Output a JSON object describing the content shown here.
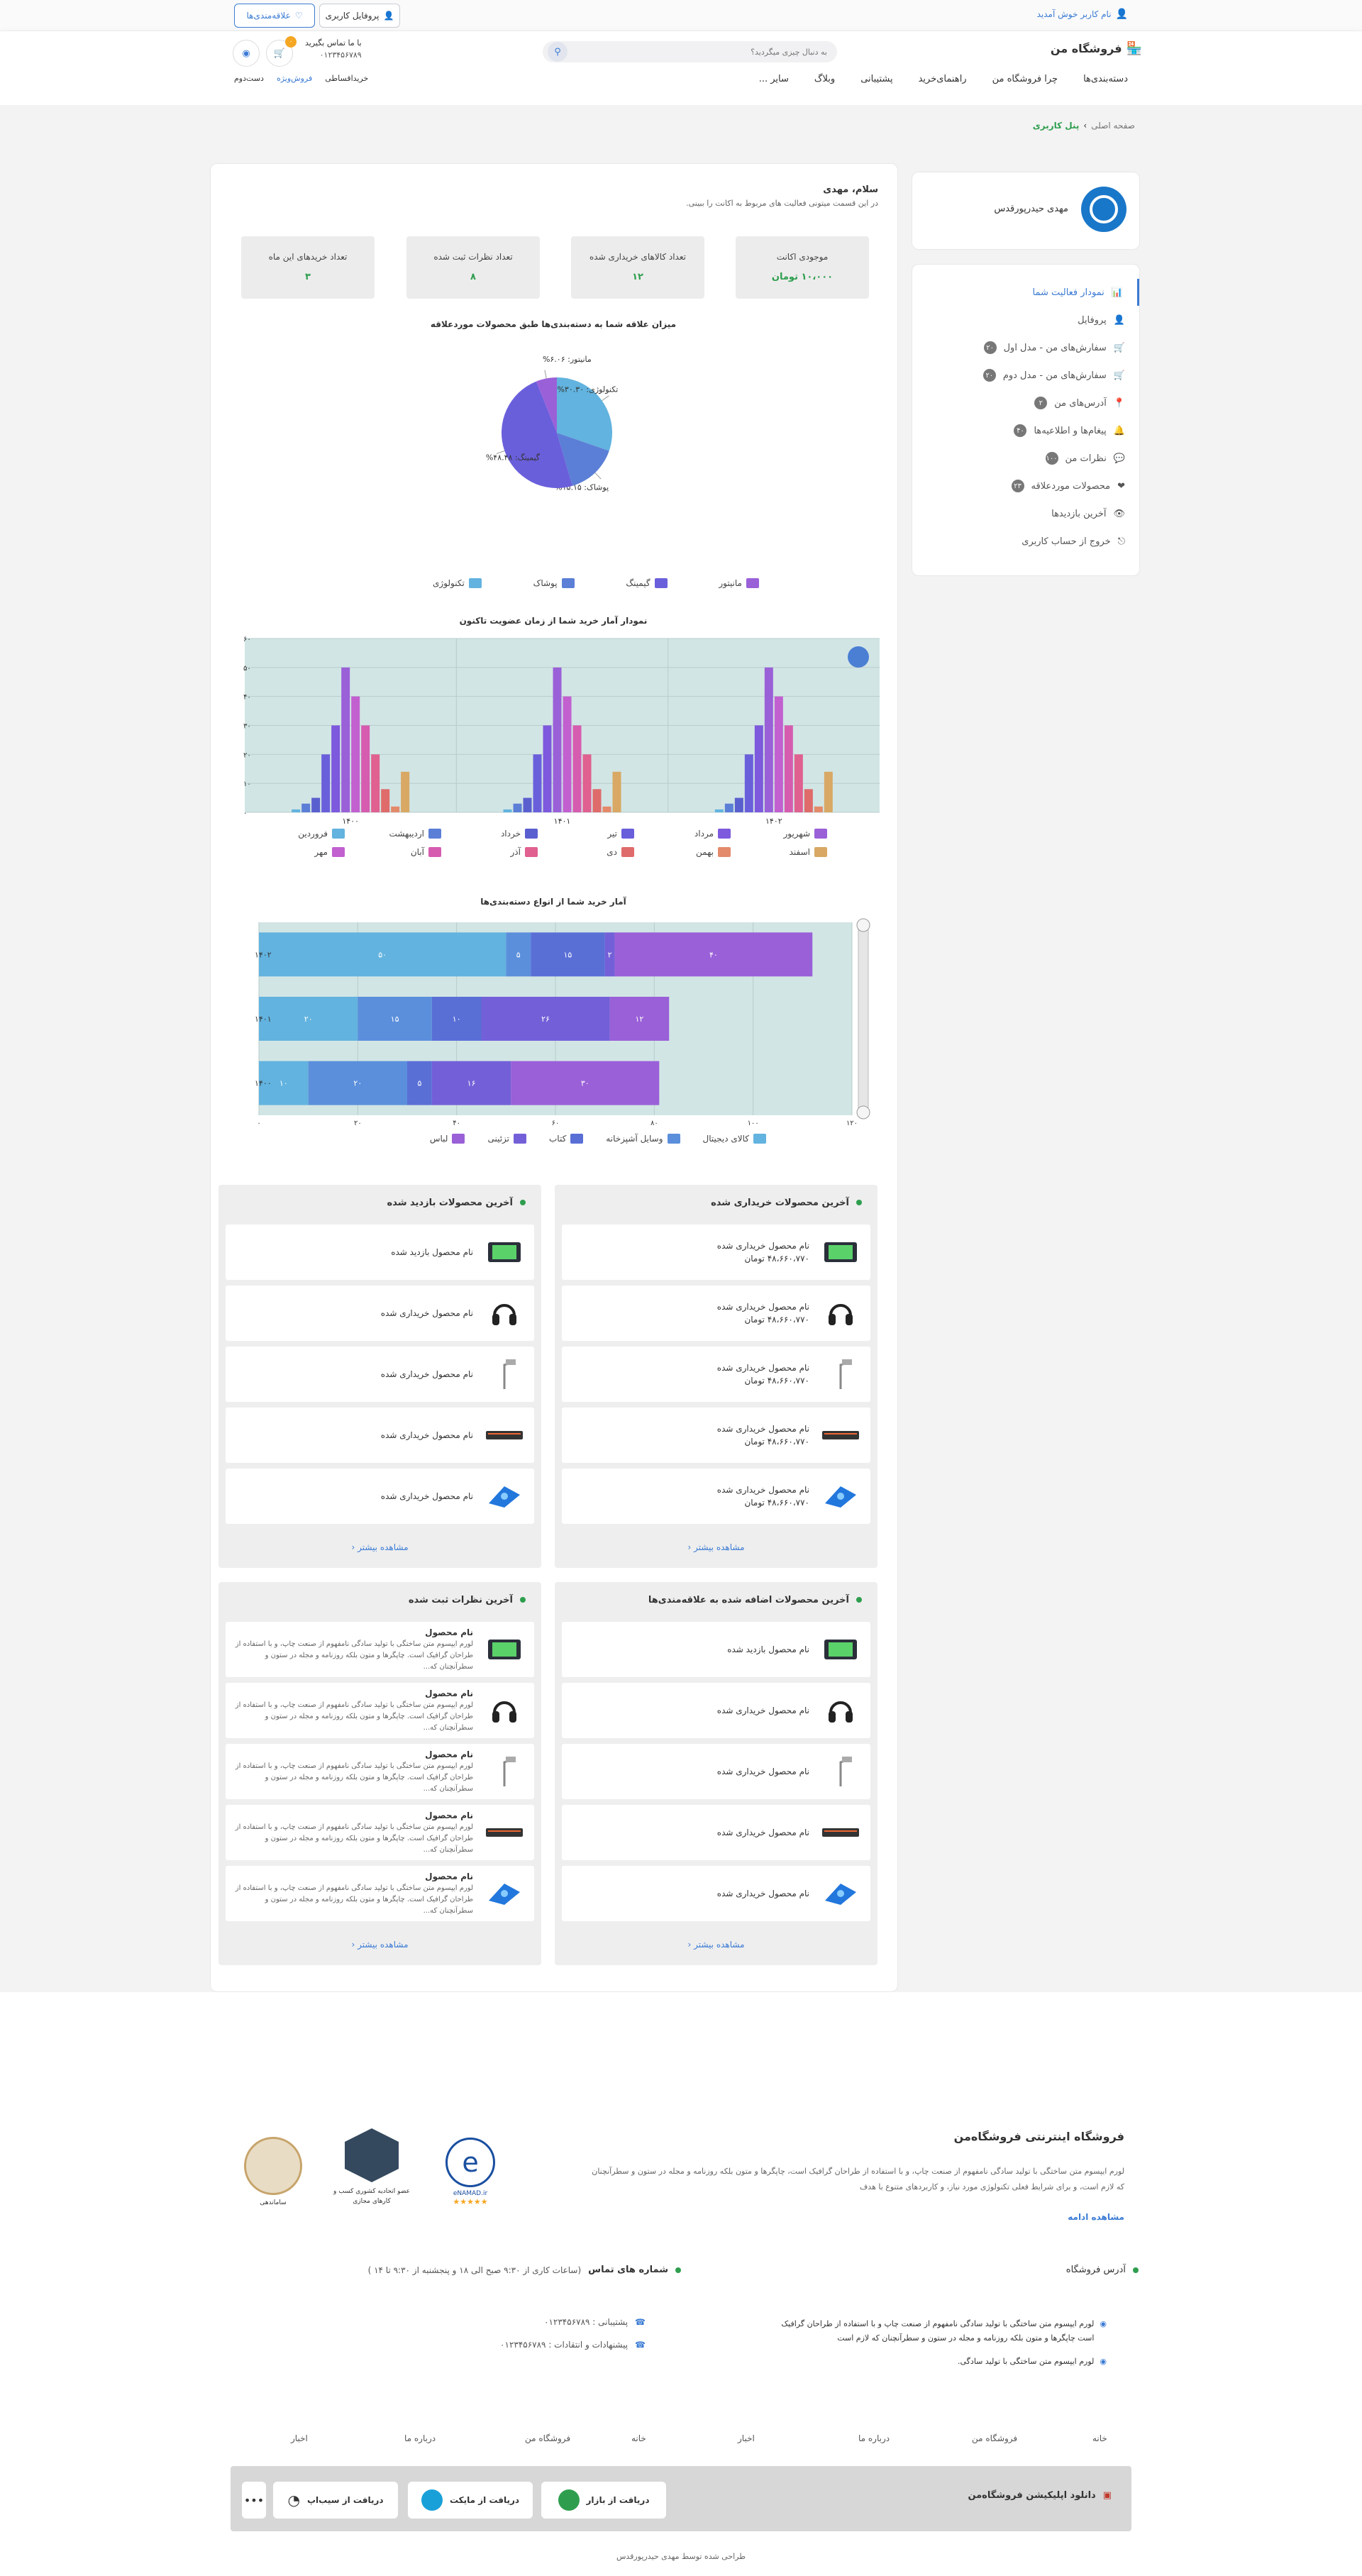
{
  "topbar": {
    "welcome": "نام کاربر خوش آمدید",
    "profile_btn": "پروفایل کاربری",
    "wishlist_btn": "علاقه‌مندی‌ها"
  },
  "header": {
    "logo": "فروشگاه من",
    "search_placeholder": "به دنبال چیزی میگردید؟",
    "contact_label": "با ما تماس بگیرید",
    "contact_phone": "۰۱۲۳۴۵۶۷۸۹",
    "cart_count": "۰",
    "nav": [
      "دسته‌بندی‌ها",
      "چرا فروشگاه من",
      "راهنمای‌خرید",
      "پشتیبانی",
      "وبلاگ",
      "سایر ..."
    ],
    "sub_nav": [
      "خرید‌اقساطی",
      "فروش‌ویژه",
      "دست‌دوم"
    ]
  },
  "breadcrumb": {
    "home": "صفحه اصلی",
    "current": "پنل کاربری"
  },
  "sidebar": {
    "user_name": "مهدی حیدرپورقدس",
    "items": [
      {
        "label": "نمودار فعالیت شما",
        "badge": ""
      },
      {
        "label": "پروفایل",
        "badge": ""
      },
      {
        "label": "سفارش‌های من - مدل اول",
        "badge": "۲۰"
      },
      {
        "label": "سفارش‌های من - مدل دوم",
        "badge": "۲۰"
      },
      {
        "label": "آدرس‌های من",
        "badge": "۲"
      },
      {
        "label": "پیغام‌ها و اطلاعیه‌ها",
        "badge": "۴۰"
      },
      {
        "label": "نظرات من",
        "badge": "۱۰۰"
      },
      {
        "label": "محصولات مورد‌علاقه",
        "badge": "۲۳"
      },
      {
        "label": "آخرین بازدیدها",
        "badge": ""
      },
      {
        "label": "خروج از حساب کاربری",
        "badge": ""
      }
    ]
  },
  "main": {
    "greeting": "سلام، مهدی",
    "intro": "در این قسمت میتونی فعالیت های مربوط به اکانت را ببینی.",
    "stats": [
      {
        "title": "موجودی اکانت",
        "value": "۱۰،۰۰۰ تومان"
      },
      {
        "title": "تعداد کالاهای خریداری شده",
        "value": "۱۲"
      },
      {
        "title": "تعداد نظرات ثبت شده",
        "value": "۸"
      },
      {
        "title": "تعداد خریدهای این ماه",
        "value": "۳"
      }
    ]
  },
  "chart_data": [
    {
      "type": "pie",
      "title": "میزان علاقه شما به دسته‌بندی‌ها طبق محصولات مورد‌علاقه",
      "categories": [
        "تکنولوژی",
        "پوشاک",
        "گیمینگ",
        "مانیتور"
      ],
      "values": [
        30.3,
        15.15,
        48.48,
        6.06
      ],
      "slice_labels": [
        "تکنولوژی: ۳۰.۳۰%",
        "پوشاک: ۱۵.۱۵%",
        "گیمینگ: ۴۸.۴۸%",
        "مانیتور: ۶.۰۶%"
      ],
      "colors": [
        "#62b3df",
        "#5b7fd6",
        "#6a5fdb",
        "#9a60d8"
      ]
    },
    {
      "type": "bar",
      "title": "نمودار آمار خرید شما از زمان عضویت تاکنون",
      "categories": [
        "۱۴۰۰",
        "۱۴۰۱",
        "۱۴۰۲"
      ],
      "ylim": [
        0,
        60
      ],
      "yticks": [
        "۰",
        "۱۰",
        "۲۰",
        "۳۰",
        "۴۰",
        "۵۰",
        "۶۰"
      ],
      "series": [
        {
          "name": "فروردین",
          "color": "#62b3df",
          "values": [
            1,
            1,
            1
          ]
        },
        {
          "name": "اردیبهشت",
          "color": "#5b7fd6",
          "values": [
            3,
            3,
            3
          ]
        },
        {
          "name": "خرداد",
          "color": "#5a5fcf",
          "values": [
            5,
            5,
            5
          ]
        },
        {
          "name": "تیر",
          "color": "#6a5fdb",
          "values": [
            20,
            20,
            20
          ]
        },
        {
          "name": "مرداد",
          "color": "#7d59dd",
          "values": [
            30,
            30,
            30
          ]
        },
        {
          "name": "شهریور",
          "color": "#9a60d8",
          "values": [
            50,
            50,
            50
          ]
        },
        {
          "name": "مهر",
          "color": "#c260d0",
          "values": [
            40,
            40,
            40
          ]
        },
        {
          "name": "آبان",
          "color": "#d65cb0",
          "values": [
            30,
            30,
            30
          ]
        },
        {
          "name": "آذر",
          "color": "#e06090",
          "values": [
            20,
            20,
            20
          ]
        },
        {
          "name": "دی",
          "color": "#df6b6b",
          "values": [
            8,
            8,
            8
          ]
        },
        {
          "name": "بهمن",
          "color": "#e38a6b",
          "values": [
            2,
            2,
            2
          ]
        },
        {
          "name": "اسفند",
          "color": "#d8a864",
          "values": [
            14,
            14,
            14
          ]
        }
      ]
    },
    {
      "type": "bar",
      "orientation": "horizontal",
      "stacked": true,
      "title": "آمار خرید شما از انواع دسته‌بندی‌ها",
      "categories": [
        "۱۴۰۲",
        "۱۴۰۱",
        "۱۴۰۰"
      ],
      "xlim": [
        0,
        120
      ],
      "xticks": [
        "۰",
        "۲۰",
        "۴۰",
        "۶۰",
        "۸۰",
        "۱۰۰",
        "۱۲۰"
      ],
      "series": [
        {
          "name": "کالای دیجیتال",
          "color": "#62b3df",
          "values": [
            50,
            20,
            10
          ]
        },
        {
          "name": "وسایل آشپزخانه",
          "color": "#5b8fdc",
          "values": [
            5,
            15,
            20
          ]
        },
        {
          "name": "کتاب",
          "color": "#5a6fd6",
          "values": [
            15,
            10,
            5
          ]
        },
        {
          "name": "تزئینی",
          "color": "#7360d8",
          "values": [
            2,
            26,
            16
          ]
        },
        {
          "name": "لباس",
          "color": "#9a60d8",
          "values": [
            40,
            12,
            30
          ]
        }
      ],
      "labels": [
        [
          "۵۰",
          "۵",
          "۱۵",
          "۲",
          "۴۰"
        ],
        [
          "۲۰",
          "۱۵",
          "۱۰",
          "۲۶",
          "۱۲"
        ],
        [
          "۱۰",
          "۲۰",
          "۵",
          "۱۶",
          "۳۰"
        ]
      ]
    }
  ],
  "panels": {
    "bought": {
      "title": "آخرین محصولات خریداری شده",
      "item": "نام محصول خریداری شده",
      "price": "۴۸،۶۶۰،۷۷۰ تومان",
      "more": "مشاهده بیشتر"
    },
    "visited": {
      "title": "آخرین محصولات بازدید شده",
      "first": "نام محصول بازدید شده",
      "item": "نام محصول خریداری شده",
      "more": "مشاهده بیشتر"
    },
    "favs": {
      "title": "آخرین محصولات اضافه شده به علاقه‌مندی‌ها",
      "first": "نام محصول بازدید شده",
      "item": "نام محصول خریداری شده",
      "more": "مشاهده بیشتر"
    },
    "comments": {
      "title": "آخرین نظرات ثبت شده",
      "name": "نام محصول",
      "text": "لورم ایپسوم متن ساختگی با تولید سادگی نامفهوم از صنعت چاپ، و با استفاده از طراحان گرافیک است. چاپگرها و متون بلکه روزنامه و مجله در ستون و سطرآنچنان که...",
      "more": "مشاهده بیشتر"
    }
  },
  "footer": {
    "title": "فروشگاه اینترنتی فروشگاه‌من",
    "desc": "لورم ایپسوم متن ساختگی با تولید سادگی نامفهوم از صنعت چاپ، و با استفاده از طراحان گرافیک است، چاپگرها و متون بلکه روزنامه و مجله در ستون و سطرآنچنان که لازم است، و برای شرایط فعلی تکنولوژی مورد نیاز، و کاربردهای متنوع با هدف",
    "more": "مشاهده ادامه",
    "address_title": "آدرس فروشگاه",
    "phones_title": "شماره های تماس",
    "hours": "(ساعات کاری از ۹:۳۰ صبح الی ۱۸ و پنجشنبه از ۹:۳۰ تا ۱۴ )",
    "addr1": "لورم ایپسوم متن ساختگی با تولید سادگی نامفهوم از صنعت چاپ و با استفاده از طراحان گرافیک است چاپگرها و متون بلکه روزنامه و مجله در ستون و سطرآنچنان که لازم است",
    "addr2": "لورم ایپسوم متن ساختگی با تولید سادگی.",
    "support": "پشتیبانی : ۰۱۲۳۴۵۶۷۸۹",
    "suggest": "پیشنهادات و انتقادات : ۰۱۲۳۴۵۶۷۸۹",
    "badges": [
      "ساماندهی",
      "عضو اتحادیه کشوری کسب و کارهای مجازی",
      "eNAMAD.ir"
    ],
    "links_right": [
      "خانه",
      "فروشگاه من",
      "درباره ما",
      "اخبار"
    ],
    "links_left": [
      "خانه",
      "فروشگاه من",
      "درباره ما",
      "اخبار"
    ],
    "app_title": "دانلود اپلیکیشن فروشگاه‌من",
    "stores": [
      "دریافت از بازار",
      "دریافت از مایکت",
      "دریافت از سیب‌اپ"
    ],
    "credit": "طراحی شده توسط مهدی حیدرپورقدس"
  }
}
